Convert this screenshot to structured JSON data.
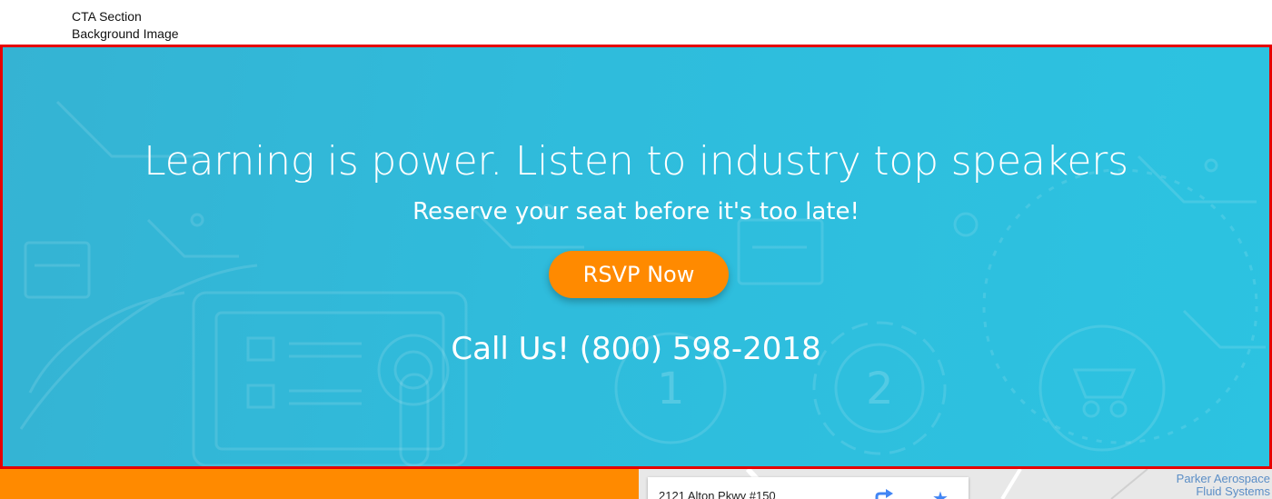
{
  "annotation": {
    "line1": "CTA Section",
    "line2": "Background Image",
    "color": "#e60000"
  },
  "cta": {
    "title": "Learning is power. Listen to industry top speakers",
    "subtitle": "Reserve your seat before it's too late!",
    "button_label": "RSVP Now",
    "phone": "Call Us! (800) 598-2018",
    "bg_color": "#2fbcdc",
    "button_color": "#ff8a00",
    "background_icons": [
      "laptop-icon",
      "hand-icon",
      "step-1-icon",
      "step-2-icon",
      "cart-icon",
      "circuit-icon"
    ]
  },
  "map": {
    "address": "2121 Alton Pkwy #150",
    "poi_line1": "Parker Aerospace",
    "poi_line2": "Fluid Systems",
    "icons": [
      "directions-icon",
      "star-icon"
    ]
  }
}
